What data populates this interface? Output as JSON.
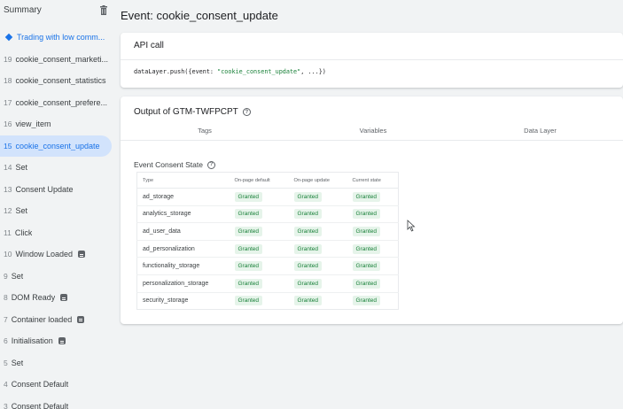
{
  "sidebar": {
    "title": "Summary",
    "container_item": "Trading with low comm...",
    "items": [
      {
        "num": "19",
        "label": "cookie_consent_marketi...",
        "badge": false
      },
      {
        "num": "18",
        "label": "cookie_consent_statistics",
        "badge": false
      },
      {
        "num": "17",
        "label": "cookie_consent_prefere...",
        "badge": false
      },
      {
        "num": "16",
        "label": "view_item",
        "badge": false
      },
      {
        "num": "15",
        "label": "cookie_consent_update",
        "badge": false,
        "active": true
      },
      {
        "num": "14",
        "label": "Set",
        "badge": false
      },
      {
        "num": "13",
        "label": "Consent Update",
        "badge": false
      },
      {
        "num": "12",
        "label": "Set",
        "badge": false
      },
      {
        "num": "11",
        "label": "Click",
        "badge": false
      },
      {
        "num": "10",
        "label": "Window Loaded",
        "badge": true
      },
      {
        "num": "9",
        "label": "Set",
        "badge": false
      },
      {
        "num": "8",
        "label": "DOM Ready",
        "badge": true
      },
      {
        "num": "7",
        "label": "Container loaded",
        "badge": true
      },
      {
        "num": "6",
        "label": "Initialisation",
        "badge": true
      },
      {
        "num": "5",
        "label": "Set",
        "badge": false
      },
      {
        "num": "4",
        "label": "Consent Default",
        "badge": false
      },
      {
        "num": "3",
        "label": "Consent Default",
        "badge": false
      }
    ]
  },
  "main": {
    "event_title": "Event: cookie_consent_update",
    "api_call": {
      "title": "API call",
      "code_prefix": "dataLayer.push({event: ",
      "code_string": "\"cookie_consent_update\"",
      "code_suffix": ", ...})"
    },
    "output": {
      "title": "Output of GTM-TWFPCPT",
      "tabs": [
        "Tags",
        "Variables",
        "Data Layer"
      ],
      "consent_title": "Event Consent State",
      "columns": [
        "Type",
        "On-page default",
        "On-page update",
        "Current state"
      ],
      "rows": [
        [
          "ad_storage",
          "Granted",
          "Granted",
          "Granted"
        ],
        [
          "analytics_storage",
          "Granted",
          "Granted",
          "Granted"
        ],
        [
          "ad_user_data",
          "Granted",
          "Granted",
          "Granted"
        ],
        [
          "ad_personalization",
          "Granted",
          "Granted",
          "Granted"
        ],
        [
          "functionality_storage",
          "Granted",
          "Granted",
          "Granted"
        ],
        [
          "personalization_storage",
          "Granted",
          "Granted",
          "Granted"
        ],
        [
          "security_storage",
          "Granted",
          "Granted",
          "Granted"
        ]
      ]
    }
  },
  "colors": {
    "accent": "#1a73e8",
    "granted_bg": "#e6f4ea",
    "granted_text": "#188038",
    "active_bg": "#d2e3fc"
  }
}
